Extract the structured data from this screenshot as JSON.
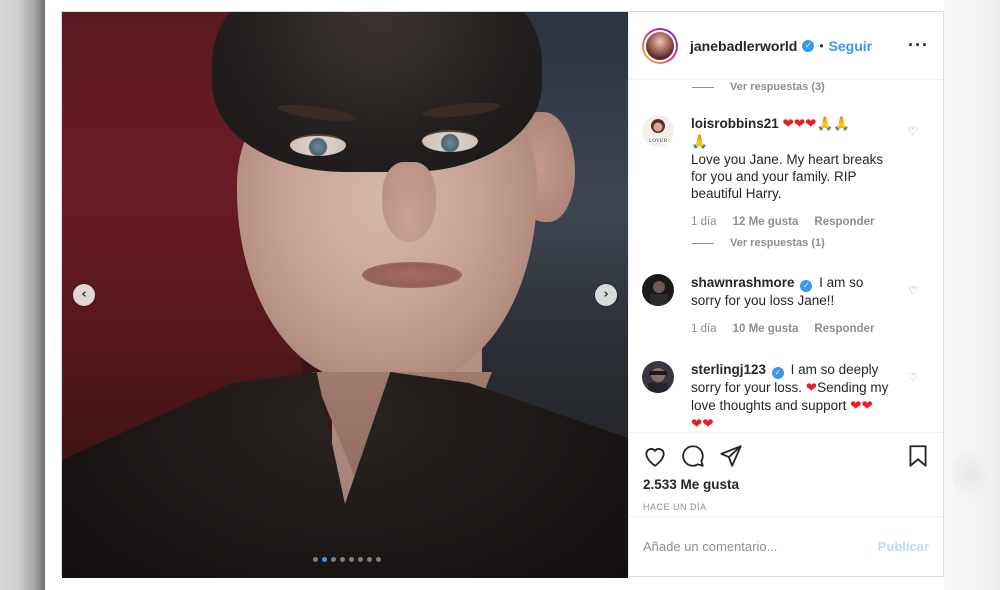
{
  "post": {
    "username": "janebadlerworld",
    "follow_label": "Seguir",
    "bullet": "•",
    "more_icon": "ellipsis-icon",
    "carousel": {
      "dots": 8,
      "active_dot": 2
    }
  },
  "comments": {
    "top_view_replies": "Ver respuestas (3)",
    "items": [
      {
        "username": "loisrobbins21",
        "verified": false,
        "emojis": "❤❤❤🙏🙏",
        "emoji_line2": "🙏",
        "text": "Love you Jane. My heart breaks for you and your family. RIP beautiful Harry.",
        "time": "1 día",
        "likes": "12 Me gusta",
        "reply": "Responder",
        "view_replies": "Ver respuestas (1)"
      },
      {
        "username": "shawnrashmore",
        "verified": true,
        "text": "I am so sorry for you loss Jane!!",
        "time": "1 día",
        "likes": "10 Me gusta",
        "reply": "Responder"
      },
      {
        "username": "sterlingj123",
        "verified": true,
        "text_part1": "I am so deeply sorry for your loss.",
        "text_part2": "Sending my love thoughts and support",
        "heart": "❤"
      }
    ]
  },
  "actions": {
    "likes_count": "2.533 Me gusta",
    "date": "HACE UN DÍA"
  },
  "add_comment": {
    "placeholder": "Añade un comentario...",
    "publish_label": "Publicar"
  },
  "colors": {
    "accent": "#3897f0",
    "muted": "#8e8e8e",
    "publish_disabled": "#b2dffc",
    "heart": "#ed1c24"
  }
}
